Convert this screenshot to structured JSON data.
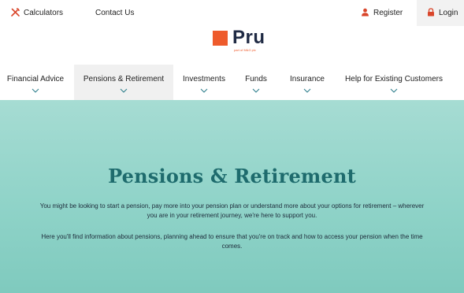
{
  "topbar": {
    "calculators": "Calculators",
    "contact_us": "Contact Us",
    "register": "Register",
    "login": "Login"
  },
  "logo": {
    "word": "Pru",
    "subtitle": "part of M&G plc"
  },
  "nav": {
    "items": [
      {
        "label": "Financial Advice"
      },
      {
        "label": "Pensions & Retirement"
      },
      {
        "label": "Investments"
      },
      {
        "label": "Funds"
      },
      {
        "label": "Insurance"
      },
      {
        "label": "Help for Existing Customers"
      }
    ],
    "active_index": 1
  },
  "hero": {
    "title": "Pensions & Retirement",
    "paragraph1": "You might be looking to start a pension, pay more into your pension plan or understand more about your options for retirement – wherever you are in your retirement journey, we're here to support you.",
    "paragraph2": "Here you'll find information about pensions, planning ahead to ensure that you're on track and how to access your pension when the time comes."
  },
  "colors": {
    "brand_orange": "#ee5b2c",
    "brand_navy": "#1f2a44",
    "hero_teal": "#8fd3c8",
    "title_teal": "#1e6b6d",
    "icon_red": "#d9462b"
  }
}
